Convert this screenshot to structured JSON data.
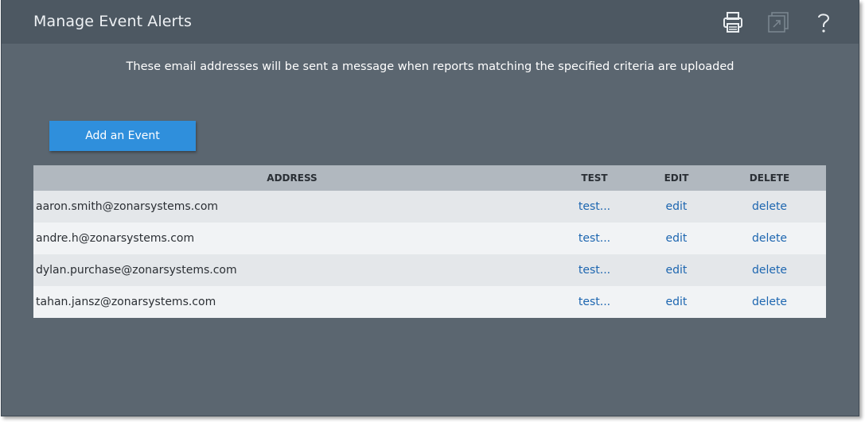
{
  "header": {
    "title": "Manage Event Alerts",
    "icons": [
      "print-icon",
      "popout-icon",
      "help-icon"
    ]
  },
  "info_text": "These email addresses will be sent a message when reports matching the specified criteria are uploaded",
  "add_button_label": "Add an Event",
  "table": {
    "columns": [
      "ADDRESS",
      "TEST",
      "EDIT",
      "DELETE"
    ],
    "rows": [
      {
        "address": "aaron.smith@zonarsystems.com",
        "test": "test...",
        "edit": "edit",
        "delete": "delete"
      },
      {
        "address": "andre.h@zonarsystems.com",
        "test": "test...",
        "edit": "edit",
        "delete": "delete"
      },
      {
        "address": "dylan.purchase@zonarsystems.com",
        "test": "test...",
        "edit": "edit",
        "delete": "delete"
      },
      {
        "address": "tahan.jansz@zonarsystems.com",
        "test": "test...",
        "edit": "edit",
        "delete": "delete"
      }
    ]
  },
  "colors": {
    "background": "#5b6670",
    "titlebar": "#4d5862",
    "accent_button": "#2f8fdc",
    "link": "#1d66b0"
  }
}
